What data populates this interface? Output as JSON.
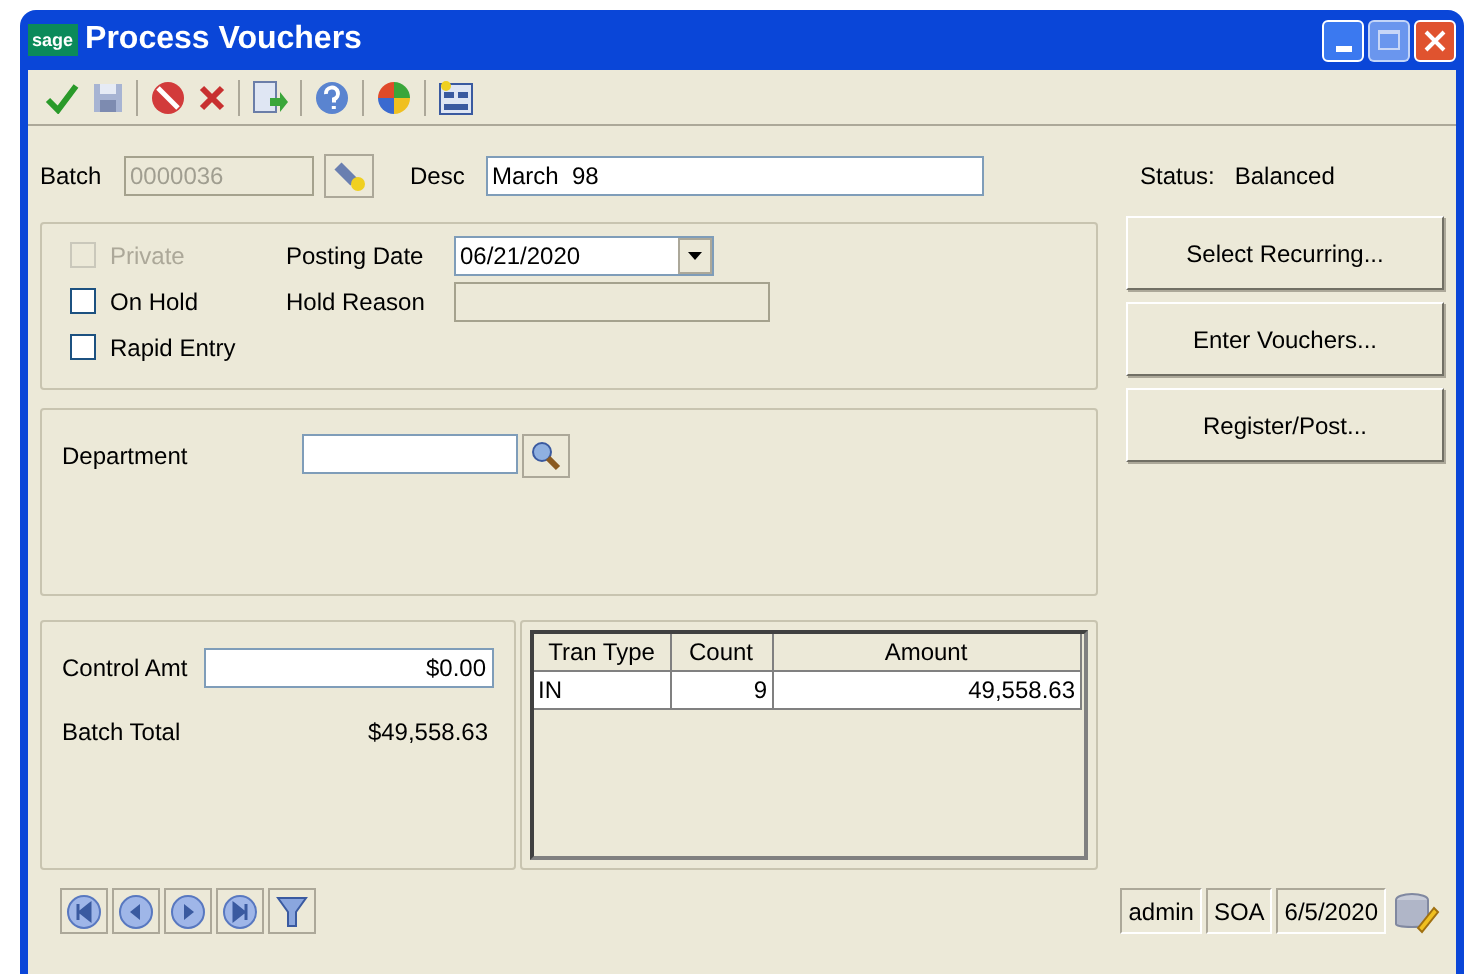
{
  "window": {
    "title": "Process Vouchers",
    "logo": "sage"
  },
  "batch": {
    "label": "Batch",
    "value": "0000036",
    "disabled": true
  },
  "desc": {
    "label": "Desc",
    "value": "March  98"
  },
  "status": {
    "label": "Status:",
    "value": "Balanced"
  },
  "options": [
    {
      "label": "Private",
      "checked": false,
      "disabled": true
    },
    {
      "label": "On Hold",
      "checked": false,
      "disabled": false
    },
    {
      "label": "Rapid Entry",
      "checked": false,
      "disabled": false
    }
  ],
  "posting_date": {
    "label": "Posting Date",
    "value": "06/21/2020"
  },
  "hold_reason": {
    "label": "Hold Reason",
    "disabled": true
  },
  "department": {
    "label": "Department"
  },
  "control_amt": {
    "label": "Control Amt",
    "value": "$0.00"
  },
  "batch_total": {
    "label": "Batch Total",
    "value": "$49,558.63"
  },
  "table": {
    "columns": [
      "Tran Type",
      "Count",
      "Amount"
    ],
    "rows": [
      [
        "IN",
        "9",
        "49,558.63"
      ]
    ]
  },
  "actions": [
    "Select Recurring...",
    "Enter Vouchers...",
    "Register/Post..."
  ],
  "status_bar": [
    "admin",
    "SOA",
    "6/5/2020"
  ]
}
